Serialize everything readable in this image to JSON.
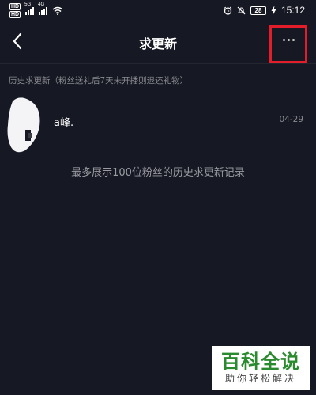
{
  "status_bar": {
    "hd1": "HD",
    "hd2": "HD",
    "signal1_label": "5G",
    "signal2_label": "4G",
    "battery": "28",
    "time": "15:12"
  },
  "nav": {
    "title": "求更新"
  },
  "history": {
    "section_title": "历史求更新（粉丝送礼后7天未开播则退还礼物）",
    "records": [
      {
        "name": "a峰.",
        "date": "04-29"
      }
    ],
    "note": "最多展示100位粉丝的历史求更新记录"
  },
  "watermark": {
    "main": "百科全说",
    "sub": "助你轻松解决"
  },
  "colors": {
    "background": "#161823",
    "highlight": "#e41d2b",
    "muted_text": "#8a8b91"
  }
}
